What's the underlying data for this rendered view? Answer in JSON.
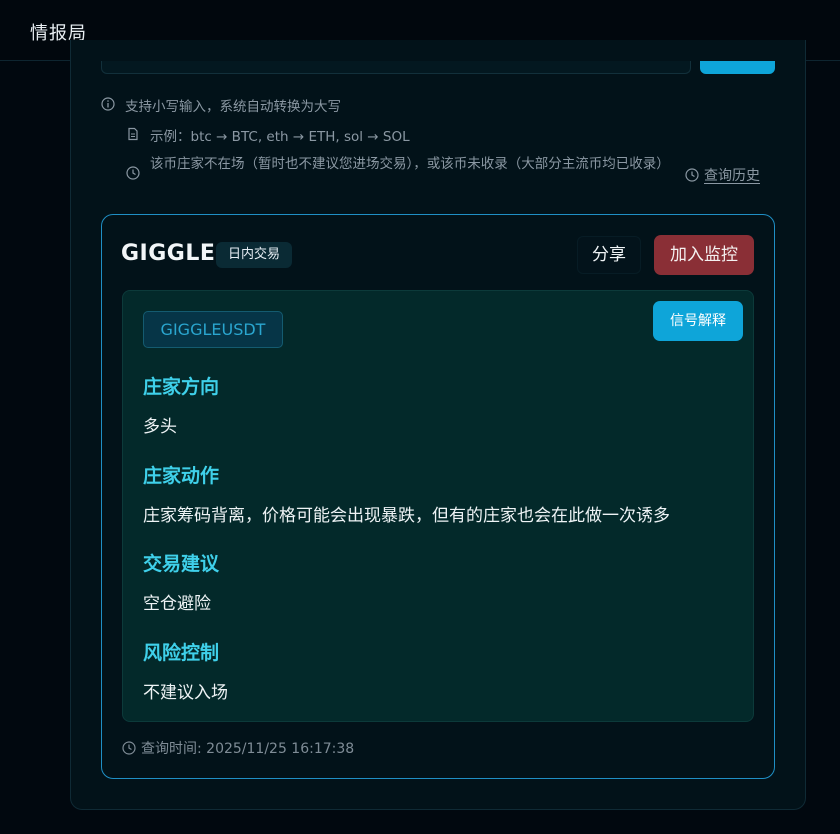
{
  "app": {
    "title": "情报局"
  },
  "hints": {
    "line1": "支持小写输入，系统自动转换为大写",
    "line2": "示例：btc → BTC, eth → ETH, sol → SOL",
    "line3": "该币庄家不在场（暂时也不建议您进场交易），或该币未收录（大部分主流币均已收录）",
    "history_label": "查询历史"
  },
  "result": {
    "symbol": "GIGGLE",
    "tag": "日内交易",
    "share_label": "分享",
    "monitor_label": "加入监控",
    "pair": "GIGGLEUSDT",
    "explain_label": "信号解释",
    "sections": [
      {
        "heading": "庄家方向",
        "body": "多头"
      },
      {
        "heading": "庄家动作",
        "body": "庄家筹码背离，价格可能会出现暴跌，但有的庄家也会在此做一次诱多"
      },
      {
        "heading": "交易建议",
        "body": "空仓避险"
      },
      {
        "heading": "风险控制",
        "body": "不建议入场"
      }
    ],
    "query_time": "查询时间: 2025/11/25 16:17:38"
  },
  "colors": {
    "accent": "#0ea5d9",
    "danger": "#8a2f36",
    "heading": "#3fd0ea",
    "card_border": "#1f8fc5"
  }
}
